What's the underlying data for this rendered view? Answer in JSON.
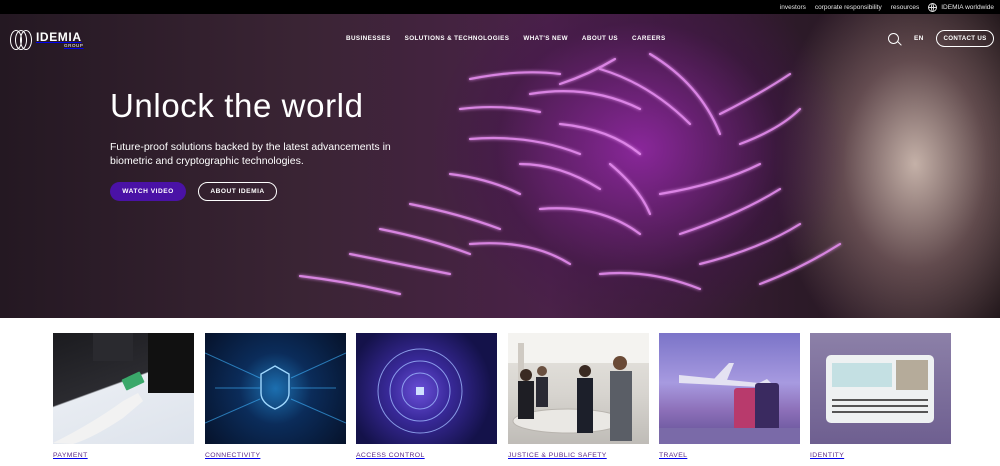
{
  "utility_bar": {
    "links": [
      "investors",
      "corporate responsibility",
      "resources"
    ],
    "worldwide_label": "IDEMIA worldwide"
  },
  "brand": {
    "name": "IDEMIA",
    "sub": "GROUP"
  },
  "nav": {
    "links": [
      "BUSINESSES",
      "SOLUTIONS & TECHNOLOGIES",
      "WHAT'S NEW",
      "ABOUT US",
      "CAREERS"
    ],
    "language": "EN",
    "contact_label": "CONTACT US"
  },
  "hero": {
    "title": "Unlock the world",
    "description": "Future-proof solutions backed by the latest advancements in biometric and cryptographic technologies.",
    "primary_button": "WATCH VIDEO",
    "secondary_button": "ABOUT IDEMIA"
  },
  "cards": [
    {
      "label": "PAYMENT"
    },
    {
      "label": "CONNECTIVITY"
    },
    {
      "label": "ACCESS CONTROL"
    },
    {
      "label": "JUSTICE & PUBLIC SAFETY"
    },
    {
      "label": "TRAVEL"
    },
    {
      "label": "IDENTITY"
    }
  ],
  "colors": {
    "accent_purple": "#4a12a6",
    "card_label": "#5b2a86",
    "topbar": "#000000"
  }
}
